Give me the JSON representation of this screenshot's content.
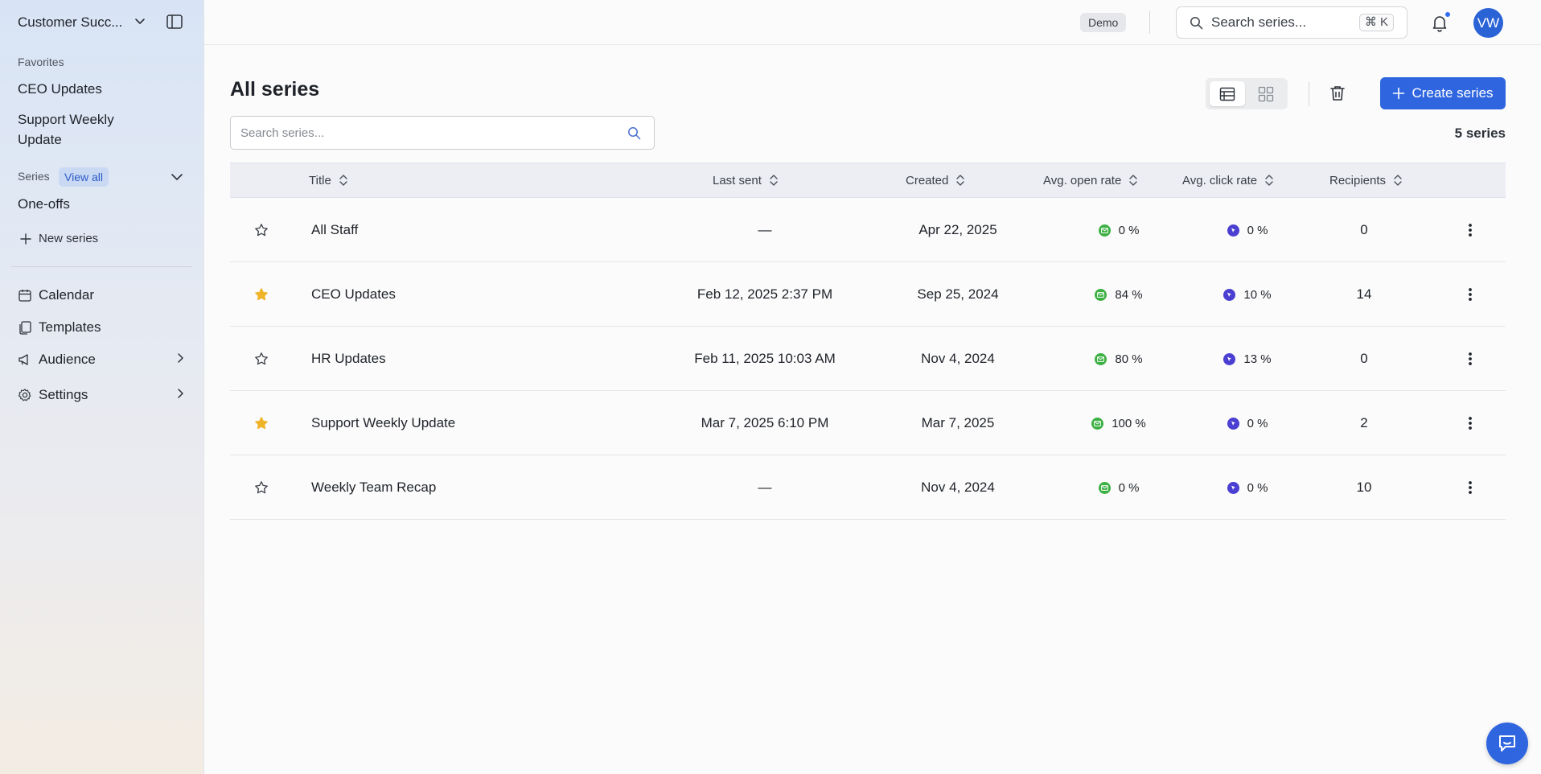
{
  "sidebar": {
    "workspace": "Customer Succ...",
    "favorites_label": "Favorites",
    "favorites": [
      "CEO Updates",
      "Support Weekly Update"
    ],
    "series_label": "Series",
    "view_all": "View all",
    "one_offs": "One-offs",
    "new_series": "New series",
    "nav": {
      "calendar": "Calendar",
      "templates": "Templates",
      "audience": "Audience",
      "settings": "Settings"
    }
  },
  "topbar": {
    "demo_badge": "Demo",
    "search_placeholder": "Search series...",
    "shortcut": "⌘ K",
    "avatar_initials": "VW"
  },
  "main": {
    "title": "All series",
    "search_placeholder": "Search series...",
    "create_label": "Create series",
    "count": "5 series",
    "columns": {
      "title": "Title",
      "last_sent": "Last sent",
      "created": "Created",
      "open_rate": "Avg. open rate",
      "click_rate": "Avg. click rate",
      "recipients": "Recipients"
    },
    "rows": [
      {
        "favorite": false,
        "title": "All Staff",
        "last_sent": "—",
        "created": "Apr 22, 2025",
        "open_rate": "0 %",
        "click_rate": "0 %",
        "recipients": "0"
      },
      {
        "favorite": true,
        "title": "CEO Updates",
        "last_sent": "Feb 12, 2025 2:37 PM",
        "created": "Sep 25, 2024",
        "open_rate": "84 %",
        "click_rate": "10 %",
        "recipients": "14"
      },
      {
        "favorite": false,
        "title": "HR Updates",
        "last_sent": "Feb 11, 2025 10:03 AM",
        "created": "Nov 4, 2024",
        "open_rate": "80 %",
        "click_rate": "13 %",
        "recipients": "0"
      },
      {
        "favorite": true,
        "title": "Support Weekly Update",
        "last_sent": "Mar 7, 2025 6:10 PM",
        "created": "Mar 7, 2025",
        "open_rate": "100 %",
        "click_rate": "0 %",
        "recipients": "2"
      },
      {
        "favorite": false,
        "title": "Weekly Team Recap",
        "last_sent": "—",
        "created": "Nov 4, 2024",
        "open_rate": "0 %",
        "click_rate": "0 %",
        "recipients": "10"
      }
    ]
  },
  "colors": {
    "accent": "#2f66e0",
    "star_active": "#f0b429",
    "open_dot": "#3cb043",
    "click_dot": "#4a3fd1"
  }
}
